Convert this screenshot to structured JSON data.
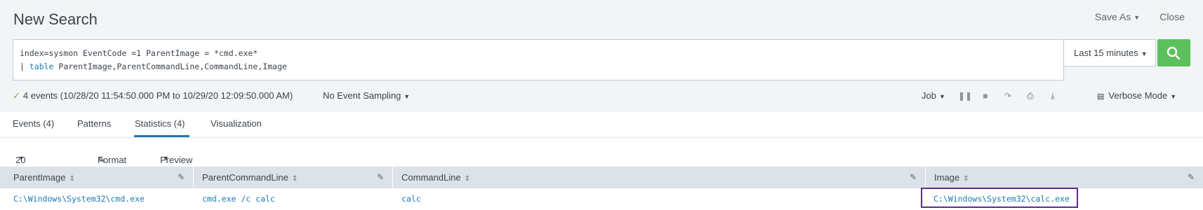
{
  "header": {
    "title": "New Search",
    "save_as": "Save As",
    "close": "Close"
  },
  "search": {
    "query_line1": "index=sysmon EventCode =1 ParentImage = *cmd.exe*",
    "query_pipe": "| ",
    "query_cmd": "table",
    "query_rest": " ParentImage,ParentCommandLine,CommandLine,Image",
    "time_range": "Last 15 minutes",
    "search_icon": "search-icon"
  },
  "status": {
    "text": "4 events (10/28/20 11:54:50.000 PM to 10/29/20 12:09:50.000 AM)",
    "sampling": "No Event Sampling",
    "job": "Job",
    "mode": "Verbose Mode"
  },
  "tabs": [
    {
      "label": "Events (4)"
    },
    {
      "label": "Patterns"
    },
    {
      "label": "Statistics (4)"
    },
    {
      "label": "Visualization"
    }
  ],
  "viewbar": {
    "per_page": "20 Per Page",
    "format": "Format",
    "preview": "Preview"
  },
  "table": {
    "columns": [
      "ParentImage",
      "ParentCommandLine",
      "CommandLine",
      "Image"
    ],
    "rows": [
      [
        "C:\\Windows\\System32\\cmd.exe",
        "cmd.exe /c calc",
        "calc",
        "C:\\Windows\\System32\\calc.exe"
      ]
    ]
  },
  "colors": {
    "accent": "#1a7ab6",
    "search_button": "#5cc05c",
    "highlight_border": "#5b2d8e"
  }
}
